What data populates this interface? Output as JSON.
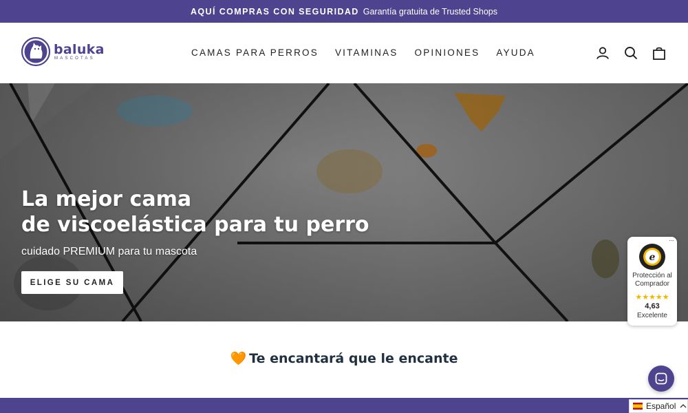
{
  "announcement": {
    "strong": "AQUÍ COMPRAS CON SEGURIDAD",
    "text": "Garantía gratuita de Trusted Shops"
  },
  "logo": {
    "name": "baluka",
    "sub": "MASCOTAS"
  },
  "nav": [
    {
      "label": "CAMAS PARA PERROS"
    },
    {
      "label": "VITAMINAS"
    },
    {
      "label": "OPINIONES"
    },
    {
      "label": "AYUDA"
    }
  ],
  "icons": {
    "account": "user-icon",
    "search": "search-icon",
    "cart": "bag-icon"
  },
  "hero": {
    "title_line1": "La mejor cama",
    "title_line2": "de viscoelástica para tu perro",
    "subtitle": "cuidado PREMIUM para tu mascota",
    "cta": "ELIGE SU CAMA"
  },
  "trust_badge": {
    "dots": "···",
    "label": "Protección al Comprador",
    "stars": "★★★★★",
    "score": "4,63",
    "rating_word": "Excelente"
  },
  "section": {
    "heart": "🧡",
    "title": "Te encantará que le encante"
  },
  "language": {
    "current": "Español"
  },
  "colors": {
    "brand": "#4e438f",
    "accent": "#f08a24"
  }
}
